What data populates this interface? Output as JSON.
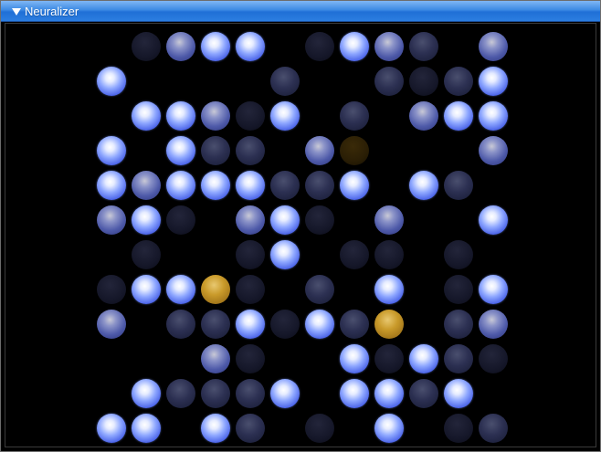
{
  "window": {
    "title": "Neuralizer"
  },
  "grid": {
    "rows": 12,
    "cols": 12,
    "states": [
      [
        "none",
        "faint",
        "mid",
        "on",
        "on",
        "none",
        "faint",
        "on",
        "mid",
        "dim",
        "none",
        "mid"
      ],
      [
        "on",
        "none",
        "none",
        "none",
        "none",
        "dim",
        "none",
        "none",
        "dim",
        "faint",
        "dim",
        "on"
      ],
      [
        "none",
        "on",
        "on",
        "mid",
        "faint",
        "on",
        "none",
        "dim",
        "none",
        "mid",
        "on",
        "on"
      ],
      [
        "on",
        "none",
        "on",
        "dim",
        "dim",
        "none",
        "mid",
        "goldfaint",
        "none",
        "none",
        "none",
        "mid"
      ],
      [
        "on",
        "mid",
        "on",
        "on",
        "on",
        "dim",
        "dim",
        "on",
        "none",
        "on",
        "dim",
        "none"
      ],
      [
        "mid",
        "on",
        "faint",
        "none",
        "mid",
        "on",
        "faint",
        "none",
        "mid",
        "none",
        "none",
        "on"
      ],
      [
        "none",
        "faint",
        "none",
        "none",
        "faint",
        "on",
        "none",
        "faint",
        "faint",
        "none",
        "faint",
        "none"
      ],
      [
        "faint",
        "on",
        "on",
        "gold",
        "faint",
        "none",
        "dim",
        "none",
        "on",
        "none",
        "faint",
        "on"
      ],
      [
        "mid",
        "none",
        "dim",
        "dim",
        "on",
        "faint",
        "on",
        "dim",
        "gold",
        "none",
        "dim",
        "mid"
      ],
      [
        "none",
        "none",
        "none",
        "mid",
        "faint",
        "none",
        "none",
        "on",
        "faint",
        "on",
        "dim",
        "faint"
      ],
      [
        "none",
        "on",
        "dim",
        "dim",
        "dim",
        "on",
        "none",
        "on",
        "on",
        "dim",
        "on",
        "none"
      ],
      [
        "on",
        "on",
        "none",
        "on",
        "dim",
        "none",
        "faint",
        "none",
        "on",
        "none",
        "faint",
        "dim"
      ]
    ]
  }
}
